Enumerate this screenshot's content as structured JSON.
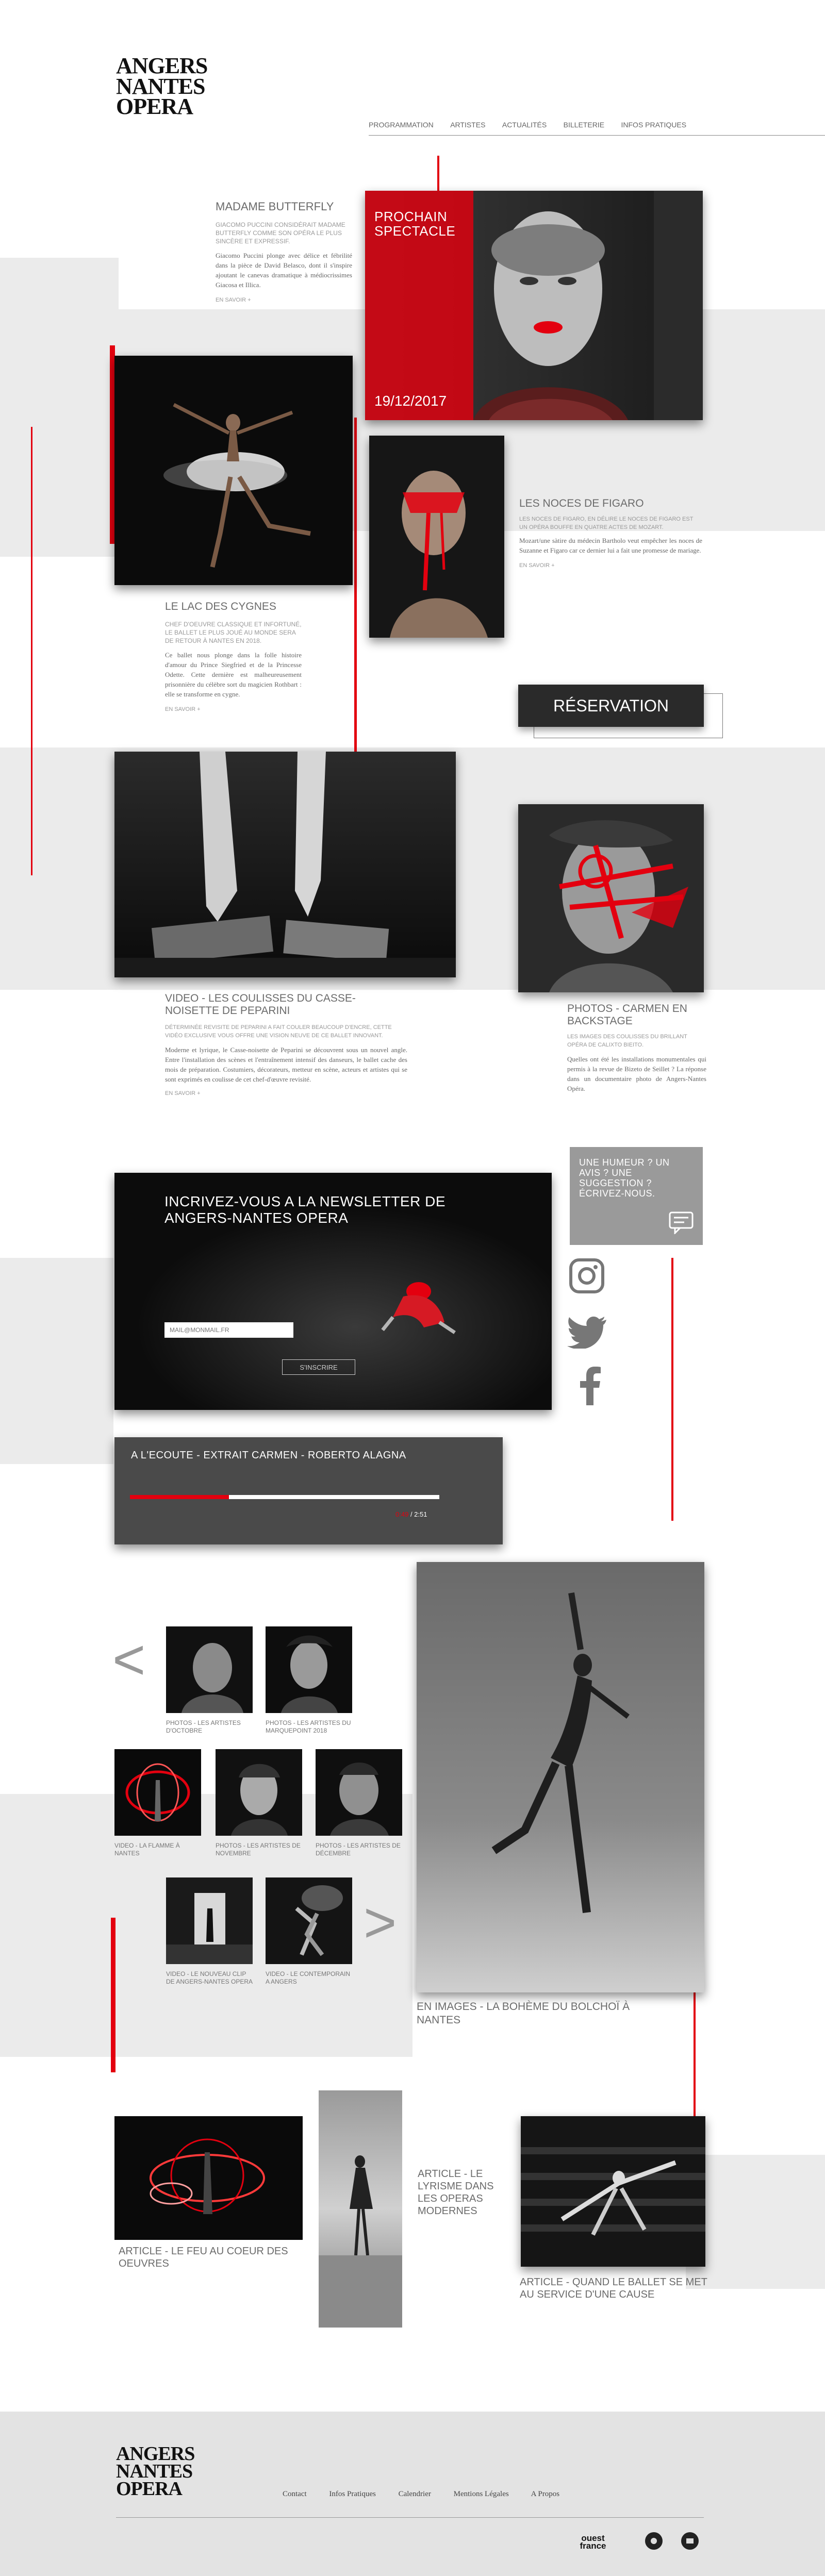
{
  "brand": {
    "logo": [
      "ANGERS",
      "NANTES",
      "OPERA"
    ]
  },
  "nav": [
    "PROGRAMMATION",
    "ARTISTES",
    "ACTUALITÉS",
    "BILLETERIE",
    "INFOS PRATIQUES"
  ],
  "hero": {
    "label_line1": "PROCHAIN",
    "label_line2": "SPECTACLE",
    "date": "19/12/2017"
  },
  "butterfly": {
    "title": "MADAME BUTTERFLY",
    "sub": "GIACOMO PUCCINI CONSIDÉRAIT MADAME BUTTERFLY COMME SON OPÉRA LE PLUS SINCÈRE ET EXPRESSIF.",
    "body": "Giacomo Puccini plonge avec délice et fébrilité dans la pièce de David Belasco, dont il s'inspire ajoutant le canevas dramatique à médiocrissimes Giacosa et Illica.",
    "more": "EN SAVOIR +"
  },
  "lac": {
    "title": "LE LAC DES CYGNES",
    "sub": "CHEF D'OEUVRE CLASSIQUE ET INFORTUNÉ, LE BALLET LE PLUS JOUÉ AU MONDE SERA DE RETOUR À NANTES EN 2018.",
    "body": "Ce ballet nous plonge dans la folle histoire d'amour du Prince Siegfried et de la Princesse Odette. Cette dernière est malheureusement prisonnière du célèbre sort du magicien Rothbart : elle se transforme en cygne.",
    "more": "EN SAVOIR +"
  },
  "figaro": {
    "title": "LES NOCES DE FIGARO",
    "sub": "LES NOCES DE FIGARO, EN DÉLIRE LE NOCES DE FIGARO EST UN OPÉRA BOUFFE EN QUATRE ACTES DE MOZART.",
    "body": "Mozart/une sàtire du médecin Bartholo veut empêcher les noces de Suzanne et Figaro car ce dernier lui a fait une promesse de mariage.",
    "more": "EN SAVOIR +"
  },
  "reservation": {
    "label": "RÉSERVATION"
  },
  "casse": {
    "title": "VIDEO - LES COULISSES DU CASSE-NOISETTE DE PEPARINI",
    "sub": "DÉTERMINÉE REVISITE DE PEPARINI A FAIT COULER BEAUCOUP D'ENCRE, CETTE VIDÉO EXCLUSIVE VOUS OFFRE UNE VISION NEUVE DE CE BALLET INNOVANT.",
    "body": "Moderne et lyrique, le Casse-noisette de Peparini se découvrent sous un nouvel angle. Entre l'installation des scènes et l'entraînement intensif des danseurs, le ballet cache des mois de préparation. Costumiers, décorateurs, metteur en scène, acteurs et artistes qui se sont exprimés en coulisse de cet chef-d'œuvre revisité.",
    "more": "EN SAVOIR +"
  },
  "carmen": {
    "title": "PHOTOS - CARMEN EN BACKSTAGE",
    "sub": "LES IMAGES DES COULISSES DU BRILLANT OPÉRA DE CALIXTO BIEITO.",
    "body": "Quelles ont été les installations monumentales qui permis à la revue de Bizeto de Seillet ? La réponse dans un documentaire photo de Angers-Nantes Opéra."
  },
  "humor": {
    "text": "UNE HUMEUR ? UN AVIS ? UNE SUGGESTION ? ÉCRIVEZ-NOUS."
  },
  "newsletter": {
    "title": "INCRIVEZ-VOUS A LA NEWSLETTER DE ANGERS-NANTES OPERA",
    "placeholder": "MAIL@MONMAIL.FR",
    "button": "S'INSCRIRE"
  },
  "player": {
    "title": "A L'ECOUTE - EXTRAIT CARMEN - ROBERTO ALAGNA",
    "elapsed": "0:49",
    "total": "/ 2:51",
    "progress": 0.32
  },
  "gallery": {
    "items": [
      "PHOTOS - LES ARTISTES D'OCTOBRE",
      "PHOTOS - LES ARTISTES DU MARQUEPOINT 2018",
      "VIDEO - LA FLAMME À NANTES",
      "PHOTOS - LES ARTISTES DE NOVEMBRE",
      "PHOTOS - LES ARTISTES DE DÉCEMBRE",
      "VIDEO - LE NOUVEAU CLIP DE ANGERS-NANTES OPERA",
      "VIDEO - LE CONTEMPORAIN A ANGERS"
    ],
    "prev": "<",
    "next": ">",
    "feature": "EN IMAGES - LA BOHÈME DU BOLCHOÏ À NANTES"
  },
  "articles": {
    "feu": "ARTICLE - LE FEU AU COEUR DES OEUVRES",
    "lyrisme": "ARTICLE - LE LYRISME DANS LES OPERAS MODERNES",
    "cause": "ARTICLE - QUAND LE BALLET SE MET AU SERVICE D'UNE CAUSE"
  },
  "footer": {
    "links": [
      "Contact",
      "Infos Pratiques",
      "Calendrier",
      "Mentions Légales",
      "A Propos"
    ],
    "partner": "ouest france"
  },
  "colors": {
    "accent": "#e3000f",
    "panel": "#ebebeb",
    "footer": "#e3e3e3",
    "dark": "#111111"
  }
}
